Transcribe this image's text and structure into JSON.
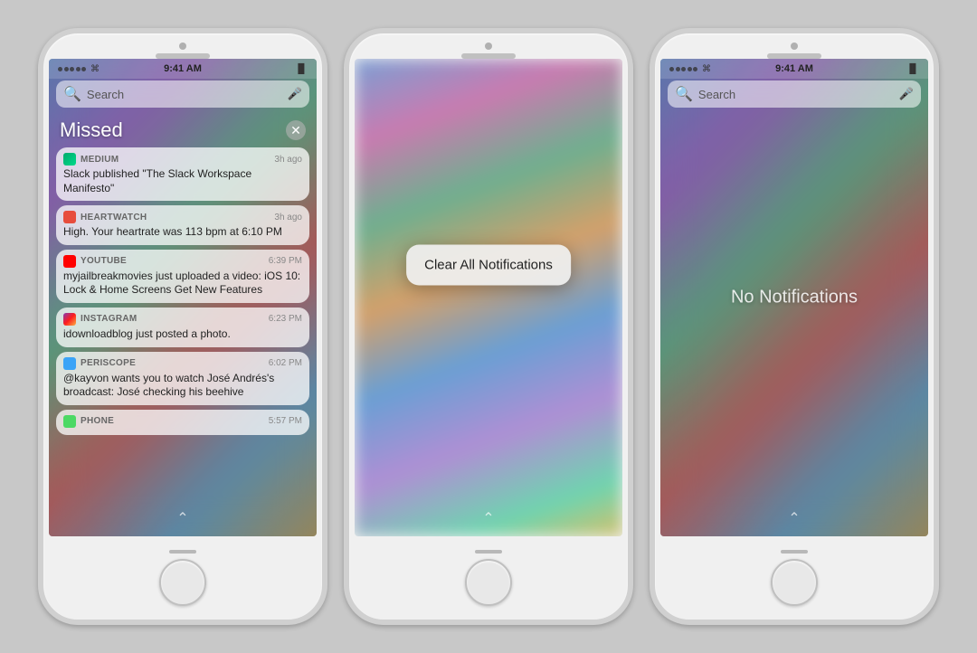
{
  "phones": {
    "left": {
      "status": {
        "time": "9:41 AM",
        "battery": "▐▌"
      },
      "search": {
        "placeholder": "Search",
        "mic": "🎤"
      },
      "section": "Missed",
      "notifications": [
        {
          "app": "Medium",
          "app_color": "icon-medium",
          "time": "3h ago",
          "body": "Slack published \"The Slack Workspace Manifesto\""
        },
        {
          "app": "Heartwatch",
          "app_color": "icon-heartwatch",
          "time": "3h ago",
          "body": "High. Your heartrate was 113 bpm at 6:10 PM"
        },
        {
          "app": "YouTube",
          "app_color": "icon-youtube",
          "time": "6:39 PM",
          "body": "myjailbreakmovies just uploaded a video: iOS 10: Lock & Home Screens Get New Features"
        },
        {
          "app": "Instagram",
          "app_color": "icon-instagram",
          "time": "6:23 PM",
          "body": "idownloadblog just posted a photo."
        },
        {
          "app": "Periscope",
          "app_color": "icon-periscope",
          "time": "6:02 PM",
          "body": "@kayvon wants you to watch José Andrés's broadcast: José checking his beehive"
        },
        {
          "app": "Phone",
          "app_color": "icon-phone",
          "time": "5:57 PM",
          "body": ""
        }
      ]
    },
    "middle": {
      "clear_dialog": "Clear All Notifications"
    },
    "right": {
      "status": {
        "time": "9:41 AM"
      },
      "search": {
        "placeholder": "Search",
        "mic": "🎤"
      },
      "no_notifications": "No Notifications"
    }
  }
}
